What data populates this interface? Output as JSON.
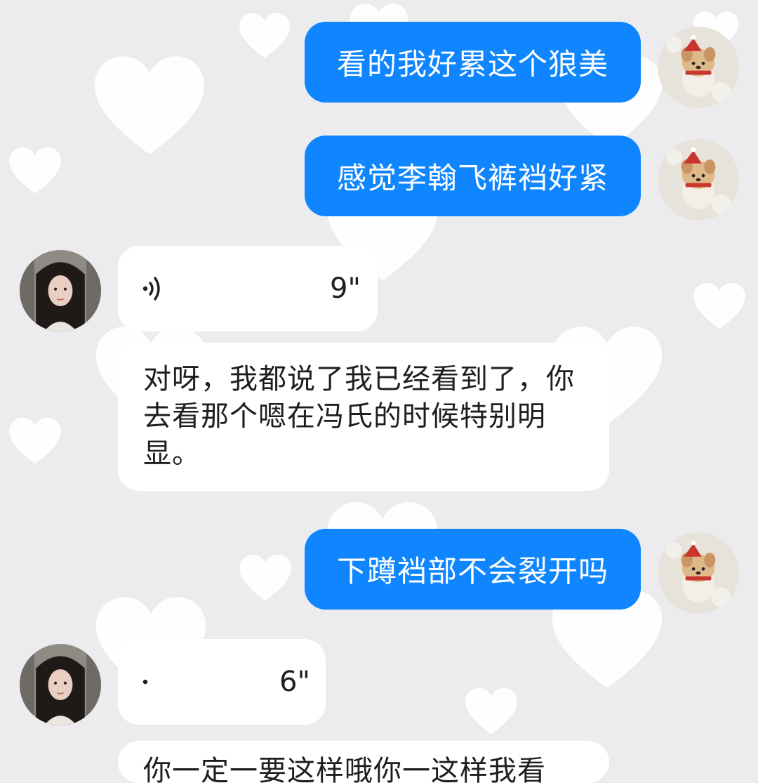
{
  "conversation": {
    "messages": [
      {
        "side": "outgoing",
        "type": "text",
        "text": "看的我好累这个狼美"
      },
      {
        "side": "outgoing",
        "type": "text",
        "text": "感觉李翰飞裤裆好紧"
      },
      {
        "side": "incoming",
        "type": "voice",
        "duration": "9\""
      },
      {
        "side": "incoming",
        "type": "text",
        "text": "对呀，我都说了我已经看到了，你去看那个嗯在冯氏的时候特别明显。"
      },
      {
        "side": "outgoing",
        "type": "text",
        "text": "下蹲裆部不会裂开吗"
      },
      {
        "side": "incoming",
        "type": "voice",
        "duration": "6\""
      },
      {
        "side": "incoming",
        "type": "text",
        "text": "你一定一要这样哦你一这样我看"
      }
    ]
  },
  "colors": {
    "outgoing_bubble": "#0f86ff",
    "incoming_bubble": "#ffffff",
    "background": "#ececef"
  },
  "icons": {
    "voice": "sound-wave-icon",
    "self_avatar": "plush-dog-avatar",
    "contact_avatar": "girl-photo-avatar"
  }
}
